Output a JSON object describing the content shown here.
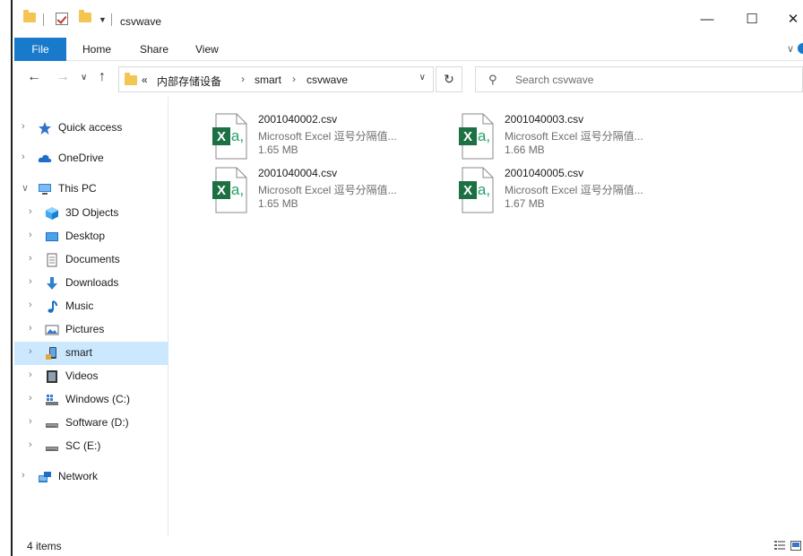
{
  "window": {
    "title": "csvwave",
    "controls": {
      "minimize": "—",
      "maximize": "☐",
      "close": "✕"
    }
  },
  "ribbon": {
    "tabs": [
      "File",
      "Home",
      "Share",
      "View"
    ],
    "expand": "∨"
  },
  "navigation": {
    "back": "←",
    "forward": "→",
    "recent": "∨",
    "up": "↑",
    "breadcrumb": {
      "overflow": "«",
      "parts": [
        "内部存储设备",
        "smart",
        "csvwave"
      ],
      "separator": "›"
    },
    "refresh": "↻",
    "search_placeholder": "Search csvwave"
  },
  "sidebar": {
    "items": [
      {
        "label": "Quick access",
        "icon": "star-icon",
        "level": 0,
        "expanded": false
      },
      {
        "label": "OneDrive",
        "icon": "cloud-icon",
        "level": 0,
        "expanded": false
      },
      {
        "label": "This PC",
        "icon": "computer-icon",
        "level": 0,
        "expanded": true
      },
      {
        "label": "3D Objects",
        "icon": "cube-icon",
        "level": 1,
        "expanded": false
      },
      {
        "label": "Desktop",
        "icon": "desktop-icon",
        "level": 1,
        "expanded": false
      },
      {
        "label": "Documents",
        "icon": "document-icon",
        "level": 1,
        "expanded": false
      },
      {
        "label": "Downloads",
        "icon": "download-icon",
        "level": 1,
        "expanded": false
      },
      {
        "label": "Music",
        "icon": "music-icon",
        "level": 1,
        "expanded": false
      },
      {
        "label": "Pictures",
        "icon": "pictures-icon",
        "level": 1,
        "expanded": false
      },
      {
        "label": "smart",
        "icon": "portable-device-icon",
        "level": 1,
        "expanded": false,
        "selected": true
      },
      {
        "label": "Videos",
        "icon": "video-icon",
        "level": 1,
        "expanded": false
      },
      {
        "label": "Windows (C:)",
        "icon": "windows-drive-icon",
        "level": 1,
        "expanded": false
      },
      {
        "label": "Software (D:)",
        "icon": "drive-icon",
        "level": 1,
        "expanded": false
      },
      {
        "label": "SC (E:)",
        "icon": "drive-icon",
        "level": 1,
        "expanded": false
      },
      {
        "label": "Network",
        "icon": "network-icon",
        "level": 0,
        "expanded": false
      }
    ]
  },
  "files": [
    {
      "name": "2001040002.csv",
      "type": "Microsoft Excel 逗号分隔值...",
      "size": "1.65 MB",
      "icon": "excel-csv-icon"
    },
    {
      "name": "2001040003.csv",
      "type": "Microsoft Excel 逗号分隔值...",
      "size": "1.66 MB",
      "icon": "excel-csv-icon"
    },
    {
      "name": "2001040004.csv",
      "type": "Microsoft Excel 逗号分隔值...",
      "size": "1.65 MB",
      "icon": "excel-csv-icon"
    },
    {
      "name": "2001040005.csv",
      "type": "Microsoft Excel 逗号分隔值...",
      "size": "1.67 MB",
      "icon": "excel-csv-icon"
    }
  ],
  "status": {
    "item_count": "4 items"
  },
  "colors": {
    "accent": "#1979ca",
    "selection": "#cce8ff",
    "excel_green": "#1d7044",
    "folder": "#f4c553"
  }
}
